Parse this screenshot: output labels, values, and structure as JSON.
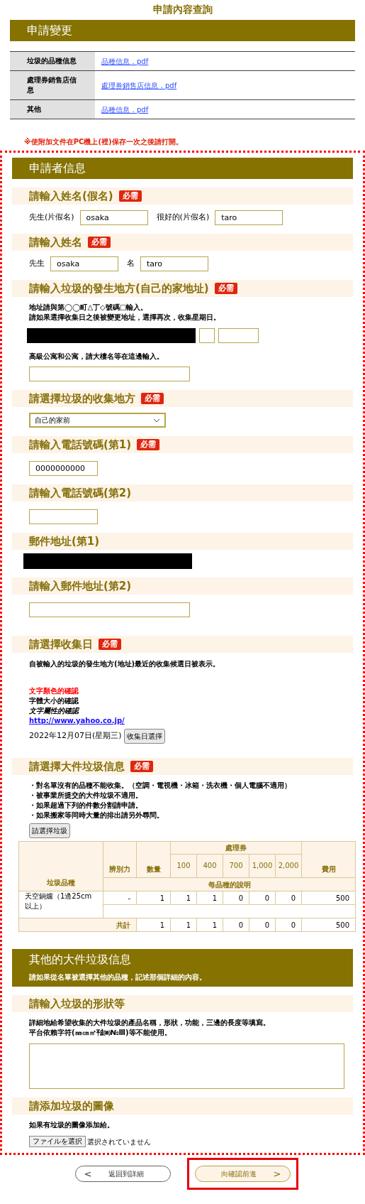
{
  "page_title": "申請內容查詢",
  "change_section": {
    "title": "申請變更",
    "rows": [
      {
        "label": "垃圾的品種信息",
        "link": "品種信息．pdf"
      },
      {
        "label": "處理券銷售店信息",
        "link": "處理券銷售店信息．pdf"
      },
      {
        "label": "其他",
        "link": "品種信息．pdf"
      }
    ]
  },
  "attachment_note": "※使附加文件在PC機上(裡)保存一次之後請打開。",
  "applicant_section": {
    "title": "申請者信息",
    "sections": [
      {
        "kind": "name_pair",
        "heading": "請輸入姓名(假名)",
        "badge": "必需",
        "pairs": [
          {
            "label": "先生(片假名)",
            "value": "osaka"
          },
          {
            "label": "很好的(片假名)",
            "value": "taro"
          }
        ]
      },
      {
        "kind": "name_pair",
        "heading": "請輸入姓名",
        "badge": "必需",
        "pairs": [
          {
            "label": "先生",
            "value": "osaka"
          },
          {
            "label": "名",
            "value": "taro"
          }
        ]
      },
      {
        "kind": "address",
        "heading": "請輸入垃圾的發生地方(自己的家地址)",
        "badge": "必需",
        "notes": [
          "地址請與第◯◯町△丁◇號碼□輸入。",
          "請如果選擇收集日之後被變更地址，選擇再次，收集星期日。"
        ],
        "note2": "高級公寓和公寓，請大樓名等在這邊輸入。"
      },
      {
        "kind": "select",
        "heading": "請選擇垃圾的收集地方",
        "badge": "必需",
        "value": "自己的家前"
      },
      {
        "kind": "input",
        "heading": "請輸入電話號碼(第1)",
        "badge": "必需",
        "value": "0000000000"
      },
      {
        "kind": "input",
        "heading": "請輸入電話號碼(第2)"
      },
      {
        "kind": "redacted",
        "heading": "郵件地址(第1)"
      },
      {
        "kind": "wide_input",
        "heading": "請輸入郵件地址(第2)"
      },
      {
        "kind": "date",
        "heading": "請選擇收集日",
        "badge": "必需",
        "description": "自被輸入的垃圾的發生地方(地址)最近的收集候選日被表示。",
        "samples": [
          {
            "kind": "red",
            "text": "文字顏色的確認"
          },
          {
            "kind": "bold",
            "text": "字體大小的確認"
          },
          {
            "kind": "italic",
            "text": "文字屬性的確認"
          },
          {
            "kind": "link",
            "text": "http://www.yahoo.co.jp/"
          }
        ],
        "date": "2022年12月07日(星期三)",
        "button": "收集日選擇"
      },
      {
        "kind": "items",
        "heading": "請選擇大件垃圾信息",
        "badge": "必需",
        "bullets": [
          "・對名單沒有的品種不能收集。（空調・電視機・冰箱・洗衣機・個人電腦不適用）",
          "・被事業所提交的大件垃圾不適用。",
          "・如果超過下列的件數分割請申請。",
          "・如果搬家等同時大量的排出請另外尋問。"
        ],
        "button": "請選擇垃圾",
        "table": {
          "item_header": "垃圾品種",
          "col_headers": [
            "辨別力",
            "數量"
          ],
          "ticket_header": "處理券",
          "ticket_values": [
            "100",
            "400",
            "700",
            "1,000",
            "2,000"
          ],
          "fee_header": "費用",
          "description_header": "每品種的說明",
          "rows": [
            {
              "item": "天空鍋爐（1邊25cm以上）",
              "cells": [
                "-",
                "1",
                "1",
                "1",
                "0",
                "0",
                "0",
                "500"
              ]
            }
          ],
          "total": {
            "label": "共計",
            "cells": [
              "1",
              "1",
              "1",
              "0",
              "0",
              "0",
              "500"
            ]
          }
        }
      }
    ]
  },
  "other_section": {
    "title": "其他的大件垃圾信息",
    "subtitle": "請如果從名單被選擇其他的品種，記述那個詳細的內容。",
    "sections": [
      {
        "kind": "textarea",
        "heading": "請輸入垃圾的形狀等",
        "notes": [
          "詳細地給希望收集的大件垃圾的產品名稱，形狀，功能，三邊的長度等填寫。",
          "平台依賴字符(㎜㎝㎡㍻㈱№Ⅲ)等不能使用。"
        ]
      },
      {
        "kind": "file",
        "heading": "請添加垃圾的圖像",
        "notes": [
          "如果有垃圾的圖像添加給。"
        ],
        "button": "ファイルを選択",
        "status": "選択されていません"
      }
    ]
  },
  "footer": {
    "buttons": [
      {
        "kind": "back",
        "arrow": "<",
        "label": "返回到詳細",
        "highlighted": false
      },
      {
        "kind": "next",
        "arrow": ">",
        "label": "向確認前進",
        "highlighted": true
      }
    ]
  }
}
